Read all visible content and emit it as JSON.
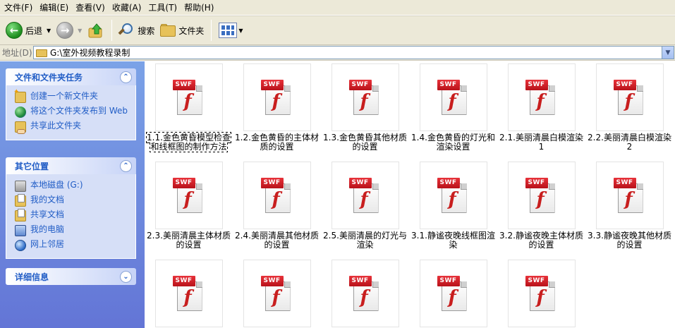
{
  "menu": [
    {
      "label": "文件(F)"
    },
    {
      "label": "编辑(E)"
    },
    {
      "label": "查看(V)"
    },
    {
      "label": "收藏(A)"
    },
    {
      "label": "工具(T)"
    },
    {
      "label": "帮助(H)"
    }
  ],
  "toolbar": {
    "back_label": "后退",
    "search_label": "搜索",
    "folders_label": "文件夹"
  },
  "address": {
    "label": "地址(D)",
    "value": "G:\\室外视频教程录制"
  },
  "tasks_panel": {
    "title": "文件和文件夹任务",
    "items": [
      {
        "label": "创建一个新文件夹",
        "icon": "new-folder-icon"
      },
      {
        "label": "将这个文件夹发布到 Web",
        "icon": "publish-web-icon"
      },
      {
        "label": "共享此文件夹",
        "icon": "share-folder-icon"
      }
    ]
  },
  "places_panel": {
    "title": "其它位置",
    "items": [
      {
        "label": "本地磁盘 (G:)",
        "icon": "disk-icon"
      },
      {
        "label": "我的文档",
        "icon": "my-documents-icon"
      },
      {
        "label": "共享文档",
        "icon": "shared-documents-icon"
      },
      {
        "label": "我的电脑",
        "icon": "my-computer-icon"
      },
      {
        "label": "网上邻居",
        "icon": "network-icon"
      }
    ]
  },
  "details_panel": {
    "title": "详细信息"
  },
  "files": [
    {
      "name": "1.1.金色黄昏模型检查和线框图的制作方法",
      "selected": true
    },
    {
      "name": "1.2.金色黄昏的主体材质的设置"
    },
    {
      "name": "1.3.金色黄昏其他材质的设置"
    },
    {
      "name": "1.4.金色黄昏的灯光和渲染设置"
    },
    {
      "name": "2.1.美丽清晨白模渲染1"
    },
    {
      "name": "2.2.美丽清晨白模渲染2"
    },
    {
      "name": "2.3.美丽清晨主体材质的设置"
    },
    {
      "name": "2.4.美丽清晨其他材质的设置"
    },
    {
      "name": "2.5.美丽清晨的灯光与渲染"
    },
    {
      "name": "3.1.静谧夜晚线框图渲染"
    },
    {
      "name": "3.2.静谧夜晚主体材质的设置"
    },
    {
      "name": "3.3.静谧夜晚其他材质的设置"
    },
    {
      "name": ""
    },
    {
      "name": ""
    },
    {
      "name": ""
    },
    {
      "name": ""
    },
    {
      "name": ""
    }
  ],
  "file_icon_badge": "SWF",
  "file_icon_glyph": "f"
}
